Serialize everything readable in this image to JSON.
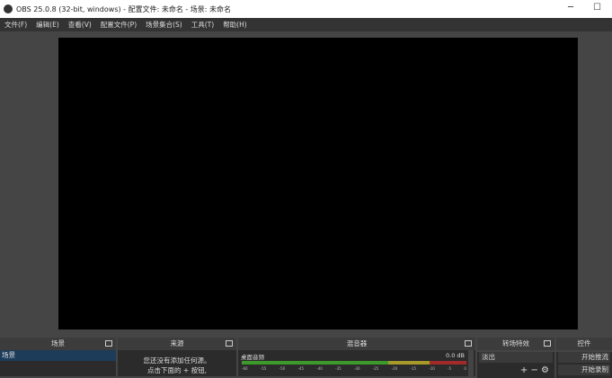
{
  "window": {
    "title": "OBS 25.0.8 (32-bit, windows) - 配置文件: 未命名 - 场景: 未命名",
    "minimize": "─",
    "maximize": "☐"
  },
  "menu": [
    "文件(F)",
    "编辑(E)",
    "查看(V)",
    "配置文件(P)",
    "场景集合(S)",
    "工具(T)",
    "帮助(H)"
  ],
  "docks": {
    "scenes": {
      "title": "场景",
      "items": [
        "场景"
      ]
    },
    "sources": {
      "title": "来源",
      "hint1": "您还没有添加任何源。",
      "hint2": "点击下面的 + 按钮,"
    },
    "mixer": {
      "title": "混音器",
      "channel": "桌面音频",
      "level": "0.0 dB",
      "ticks": [
        "-60",
        "-55",
        "-50",
        "-45",
        "-40",
        "-35",
        "-30",
        "-25",
        "-20",
        "-15",
        "-10",
        "-5",
        "0"
      ]
    },
    "transitions": {
      "title": "转场特效",
      "selected": "淡出",
      "add": "+",
      "remove": "−",
      "settings": "⚙"
    },
    "controls": {
      "title": "控件",
      "start_stream": "开始推流",
      "start_record": "开始录制"
    }
  },
  "colors": {
    "green": "#3c9a2a",
    "yellow": "#a89a2a",
    "red": "#a22a2a"
  }
}
